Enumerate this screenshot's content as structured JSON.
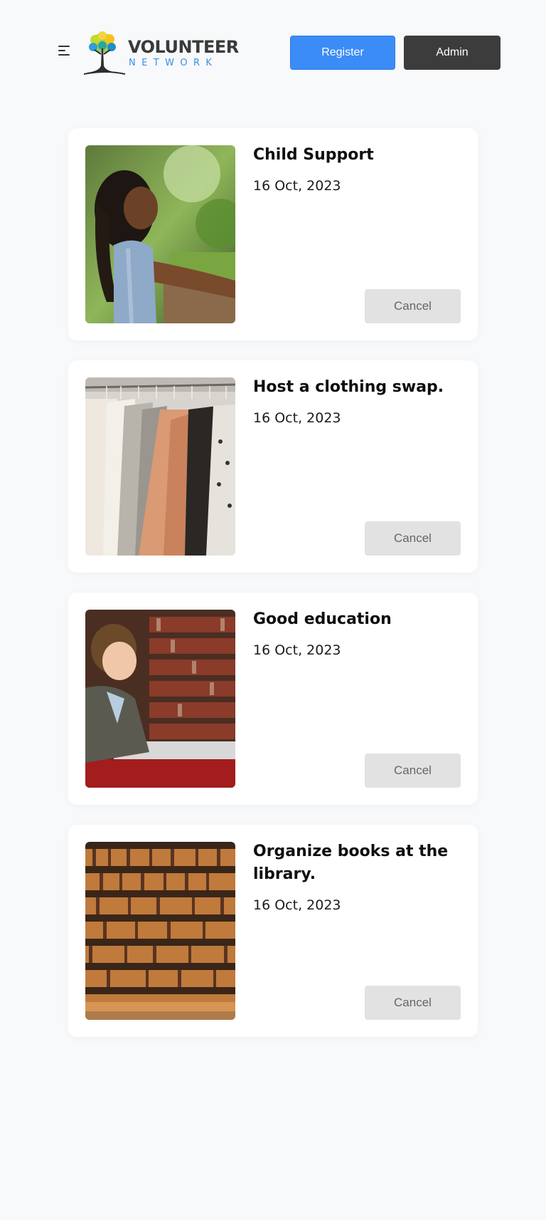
{
  "header": {
    "menu_icon": "hamburger-menu-icon",
    "logo_title": "VOLUNTEER",
    "logo_subtitle": "NETWORK",
    "register_label": "Register",
    "admin_label": "Admin",
    "colors": {
      "register_bg": "#3b8cf7",
      "admin_bg": "#3c3c3c",
      "logo_sub": "#3a8ee6"
    }
  },
  "events": [
    {
      "title": "Child Support",
      "date": "16 Oct, 2023",
      "cancel_label": "Cancel",
      "image": "girl-smiling-outdoors-photo"
    },
    {
      "title": "Host a clothing swap.",
      "date": "16 Oct, 2023",
      "cancel_label": "Cancel",
      "image": "clothing-rack-photo"
    },
    {
      "title": "Good education",
      "date": "16 Oct, 2023",
      "cancel_label": "Cancel",
      "image": "boy-reading-in-library-photo"
    },
    {
      "title": "Organize books at the library.",
      "date": "16 Oct, 2023",
      "cancel_label": "Cancel",
      "image": "library-bookshelves-photo"
    }
  ]
}
